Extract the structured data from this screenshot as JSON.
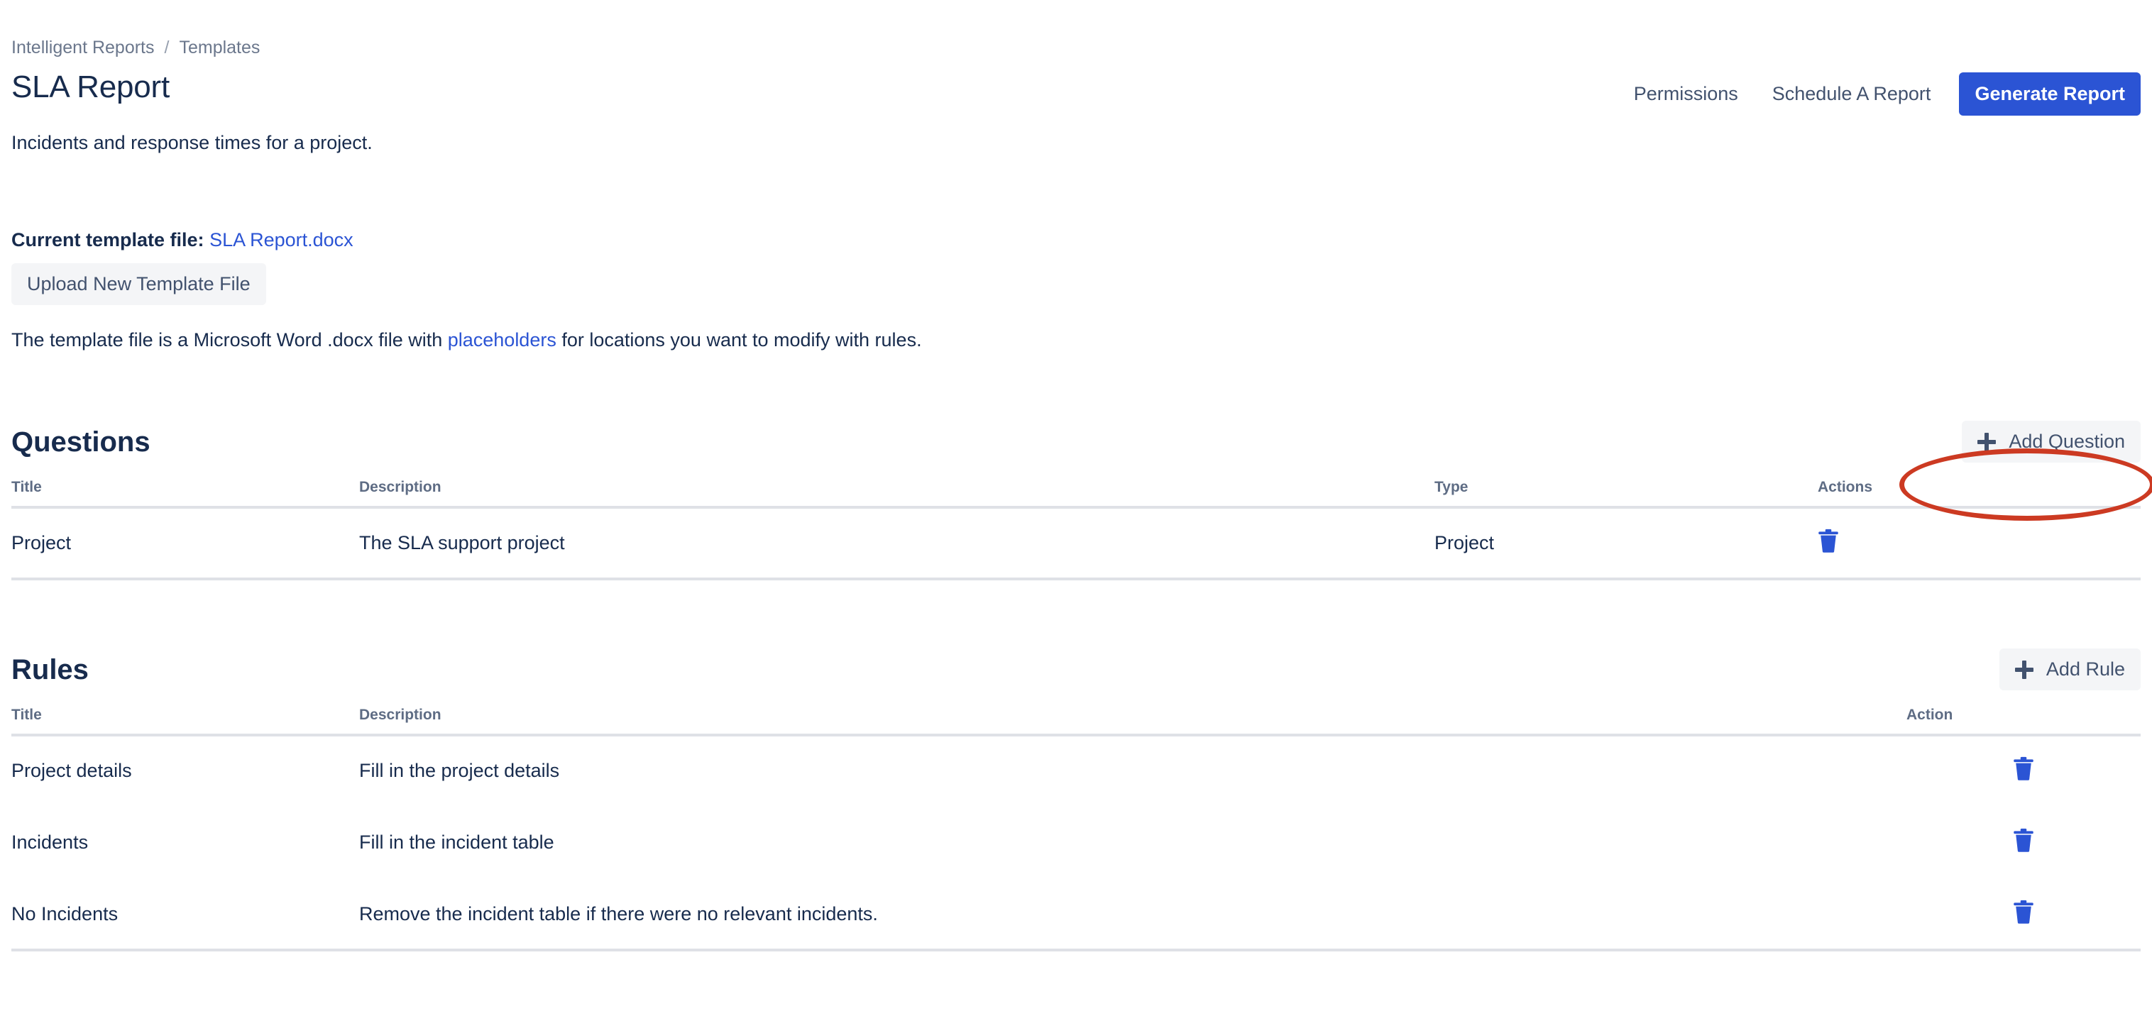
{
  "breadcrumb": {
    "root": "Intelligent Reports",
    "separator": "/",
    "current": "Templates"
  },
  "header": {
    "title": "SLA Report",
    "description": "Incidents and response times for a project.",
    "actions": {
      "permissions": "Permissions",
      "schedule": "Schedule A Report",
      "generate": "Generate Report"
    }
  },
  "template": {
    "label": "Current template file:",
    "file_name": "SLA Report.docx",
    "upload_button": "Upload New Template File",
    "help_prefix": "The template file is a Microsoft Word .docx file with ",
    "help_link": "placeholders",
    "help_suffix": " for locations you want to modify with rules."
  },
  "questions": {
    "title": "Questions",
    "add_button": "Add Question",
    "columns": {
      "title": "Title",
      "description": "Description",
      "type": "Type",
      "actions": "Actions"
    },
    "rows": [
      {
        "title": "Project",
        "description": "The SLA support project",
        "type": "Project",
        "action_icon": "trash-icon"
      }
    ]
  },
  "rules": {
    "title": "Rules",
    "add_button": "Add Rule",
    "columns": {
      "title": "Title",
      "description": "Description",
      "action": "Action"
    },
    "rows": [
      {
        "title": "Project details",
        "description": "Fill in the project details",
        "action_icon": "trash-icon"
      },
      {
        "title": "Incidents",
        "description": "Fill in the incident table",
        "action_icon": "trash-icon"
      },
      {
        "title": "No Incidents",
        "description": "Remove the incident table if there were no relevant incidents.",
        "action_icon": "trash-icon"
      }
    ]
  },
  "annotation": {
    "shape": "ellipse",
    "color": "#cc3a22",
    "target": "Add Question"
  },
  "colors": {
    "primary_blue": "#2b54d4",
    "link_blue": "#2b54d4",
    "text_dark": "#172b4d",
    "text_muted": "#6b778c",
    "soft_button_bg": "#f4f5f7",
    "divider": "#dfe1e6",
    "annotation_red": "#cc3a22"
  }
}
